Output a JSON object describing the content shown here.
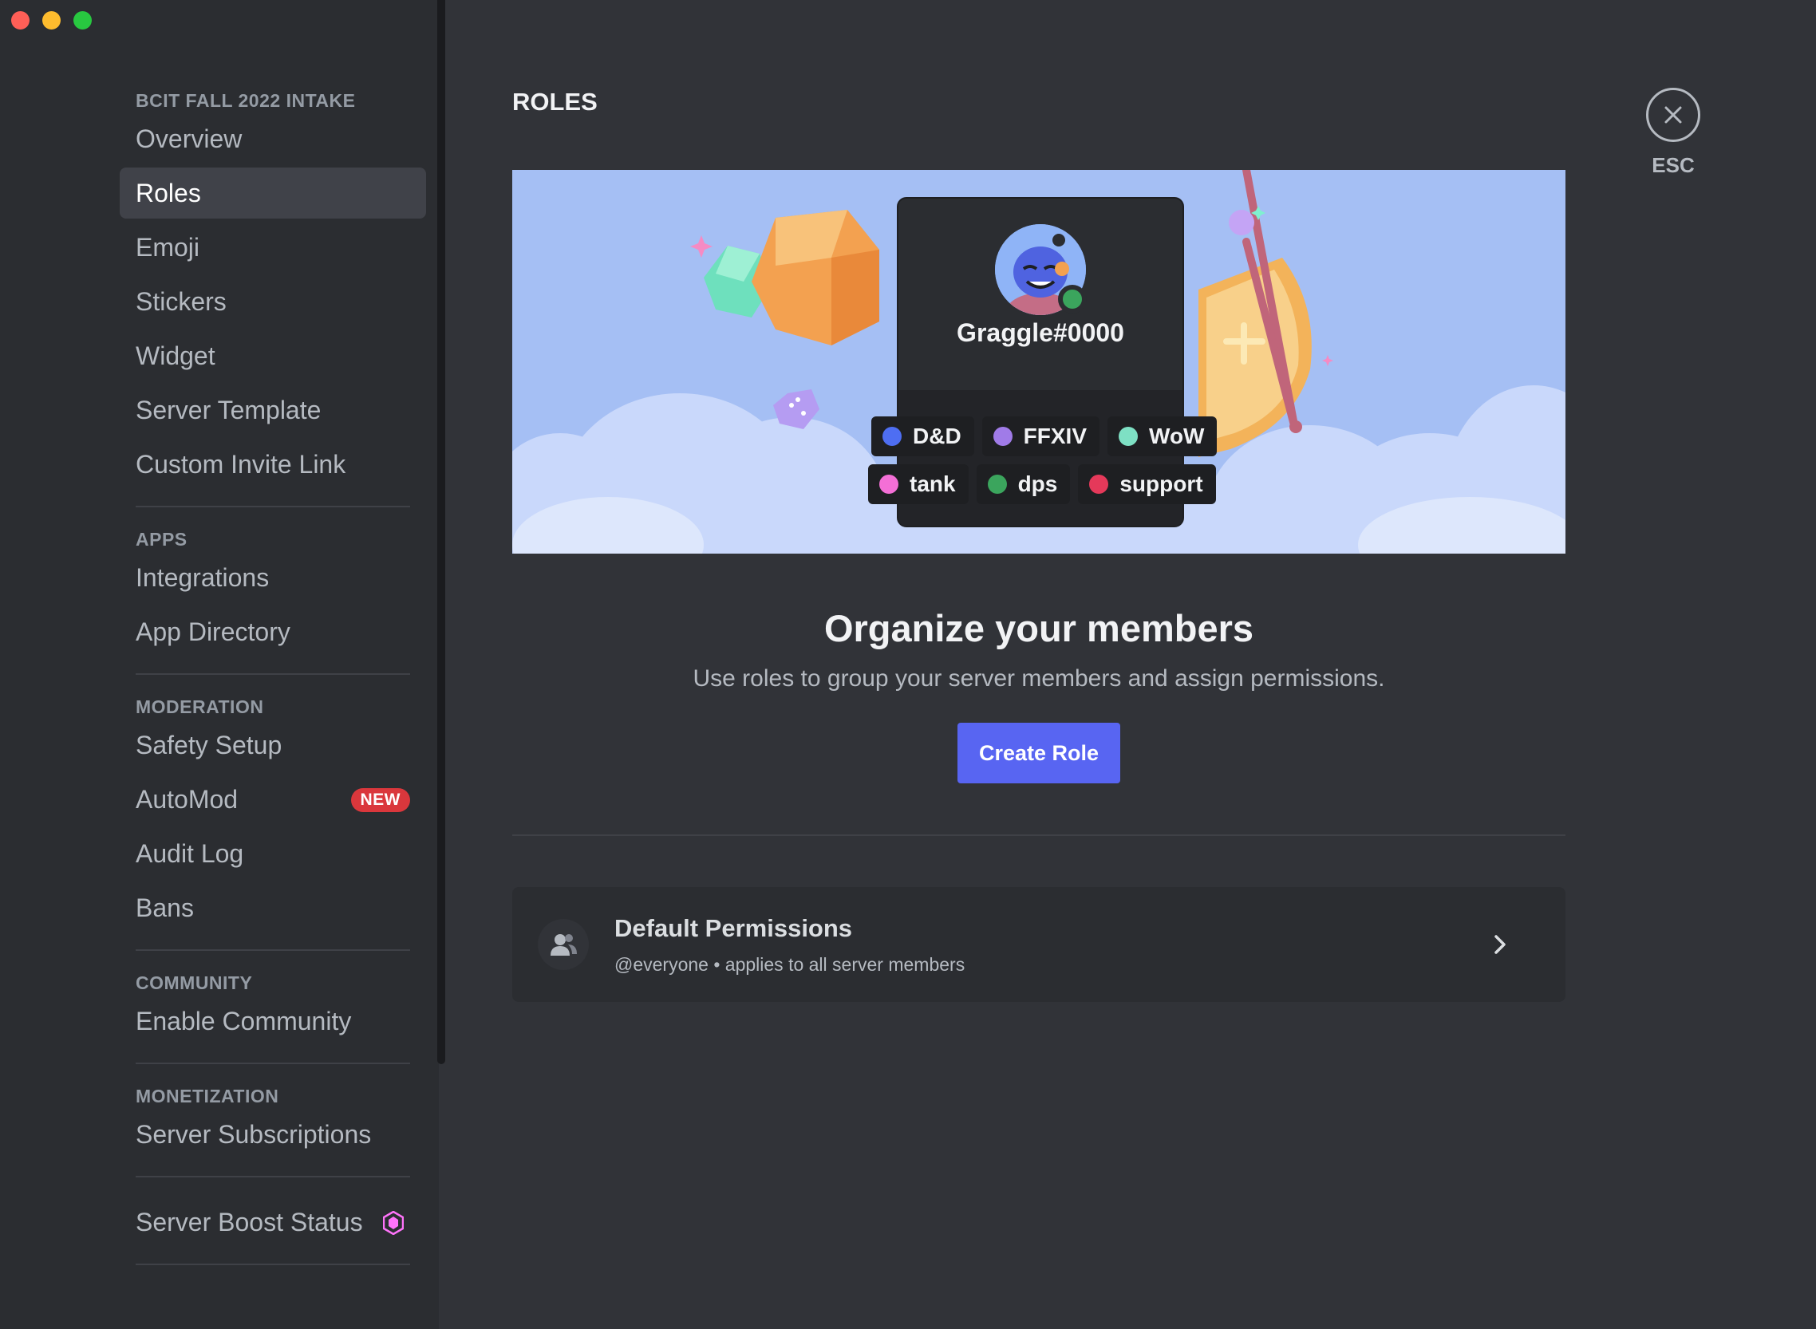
{
  "window": {
    "controls": [
      "close",
      "minimize",
      "zoom"
    ]
  },
  "sidebar": {
    "sections": [
      {
        "title": "BCIT FALL 2022 INTAKE",
        "items": [
          {
            "label": "Overview"
          },
          {
            "label": "Roles",
            "active": true
          },
          {
            "label": "Emoji"
          },
          {
            "label": "Stickers"
          },
          {
            "label": "Widget"
          },
          {
            "label": "Server Template"
          },
          {
            "label": "Custom Invite Link"
          }
        ]
      },
      {
        "title": "APPS",
        "items": [
          {
            "label": "Integrations"
          },
          {
            "label": "App Directory"
          }
        ]
      },
      {
        "title": "MODERATION",
        "items": [
          {
            "label": "Safety Setup"
          },
          {
            "label": "AutoMod",
            "badge": "NEW"
          },
          {
            "label": "Audit Log"
          },
          {
            "label": "Bans"
          }
        ]
      },
      {
        "title": "COMMUNITY",
        "items": [
          {
            "label": "Enable Community"
          }
        ]
      },
      {
        "title": "MONETIZATION",
        "items": [
          {
            "label": "Server Subscriptions"
          }
        ]
      },
      {
        "title": "",
        "items": [
          {
            "label": "Server Boost Status",
            "icon": "boost-gem-icon"
          }
        ]
      }
    ]
  },
  "main": {
    "title": "ROLES",
    "esc_label": "ESC",
    "hero": {
      "username": "Graggle#0000",
      "roles": [
        {
          "name": "D&D",
          "color": "#4e6ef2"
        },
        {
          "name": "FFXIV",
          "color": "#a07be8"
        },
        {
          "name": "WoW",
          "color": "#7ee0c4"
        },
        {
          "name": "tank",
          "color": "#f46fd6"
        },
        {
          "name": "dps",
          "color": "#3ba55d"
        },
        {
          "name": "support",
          "color": "#e5395a"
        }
      ]
    },
    "heading": "Organize your members",
    "subheading": "Use roles to group your server members and assign permissions.",
    "create_button": "Create Role",
    "default_permissions": {
      "title": "Default Permissions",
      "subtitle": "@everyone • applies to all server members",
      "icon": "members-icon"
    }
  },
  "colors": {
    "accent": "#5865f2",
    "badge_new": "#da373c",
    "boost": "#ff73fa"
  }
}
